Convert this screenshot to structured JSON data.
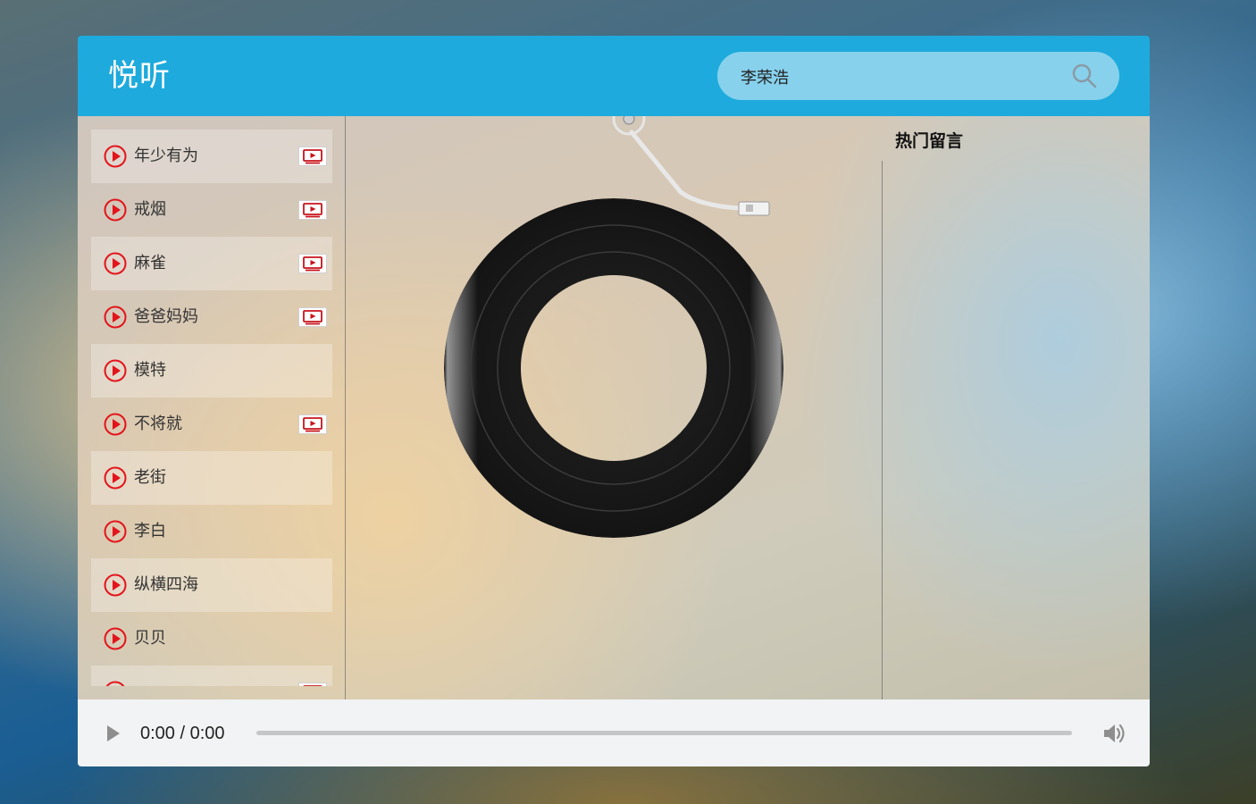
{
  "app": {
    "logo": "悦听",
    "accent_color": "#1eaadc"
  },
  "search": {
    "value": "李荣浩",
    "icon": "search-icon"
  },
  "songs": [
    {
      "name": "年少有为",
      "has_mv": true
    },
    {
      "name": "戒烟",
      "has_mv": true
    },
    {
      "name": "麻雀",
      "has_mv": true
    },
    {
      "name": "爸爸妈妈",
      "has_mv": true
    },
    {
      "name": "模特",
      "has_mv": false
    },
    {
      "name": "不将就",
      "has_mv": true
    },
    {
      "name": "老街",
      "has_mv": false
    },
    {
      "name": "李白",
      "has_mv": false
    },
    {
      "name": "纵横四海",
      "has_mv": false
    },
    {
      "name": "贝贝",
      "has_mv": false
    },
    {
      "name": "",
      "has_mv": true
    }
  ],
  "icons": {
    "play": "play-circle-icon",
    "mv": "mv-video-icon",
    "record": "vinyl-record",
    "needle": "tonearm-needle"
  },
  "comments": {
    "title": "热门留言"
  },
  "audio": {
    "time": "0:00 / 0:00",
    "progress": 0,
    "play_icon": "play-icon",
    "volume_icon": "volume-icon"
  }
}
